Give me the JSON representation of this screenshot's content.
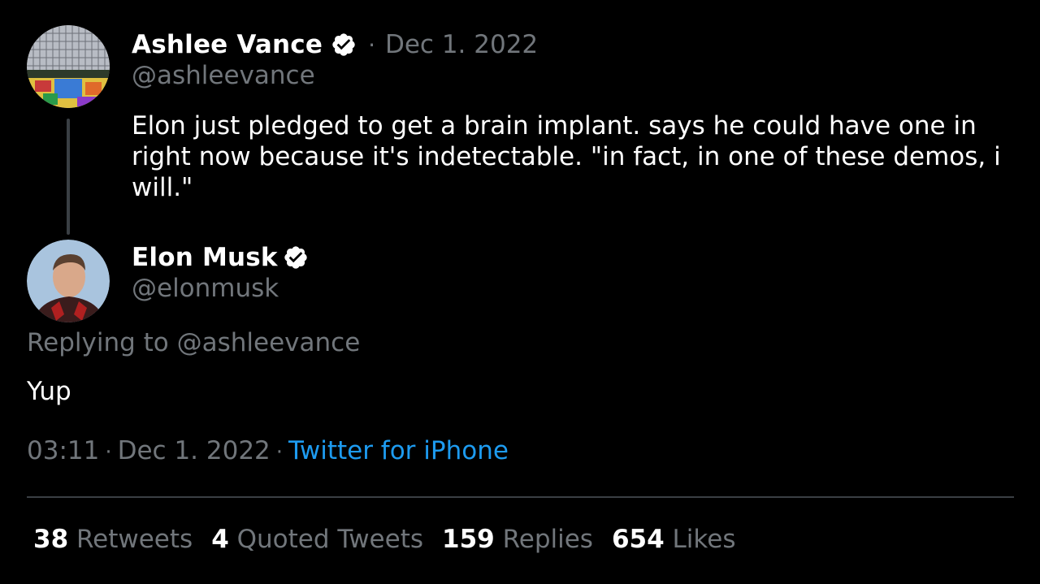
{
  "original_tweet": {
    "author": {
      "display_name": "Ashlee Vance",
      "handle": "@ashleevance",
      "verified": true,
      "avatar_icon": "avatar-ashlee-vance"
    },
    "separator": "·",
    "date": "Dec 1. 2022",
    "text": "Elon just pledged to get a brain implant. says he could have one in right now because it's indetectable. \"in fact, in one of these demos, i will.\""
  },
  "reply_tweet": {
    "author": {
      "display_name": "Elon Musk",
      "handle": "@elonmusk",
      "verified": true,
      "avatar_icon": "avatar-elon-musk"
    },
    "replying_to": "Replying to @ashleevance",
    "text": "Yup",
    "time": "03:11",
    "dot": "·",
    "date": "Dec 1. 2022",
    "source": "Twitter for iPhone"
  },
  "stats": [
    {
      "count": "38",
      "label": "Retweets"
    },
    {
      "count": "4",
      "label": "Quoted Tweets"
    },
    {
      "count": "159",
      "label": "Replies"
    },
    {
      "count": "654",
      "label": "Likes"
    }
  ],
  "colors": {
    "background": "#000000",
    "primary_text": "#ffffff",
    "secondary_text": "#71767b",
    "link": "#1d9bf0",
    "verified_badge": "#ffffff"
  }
}
